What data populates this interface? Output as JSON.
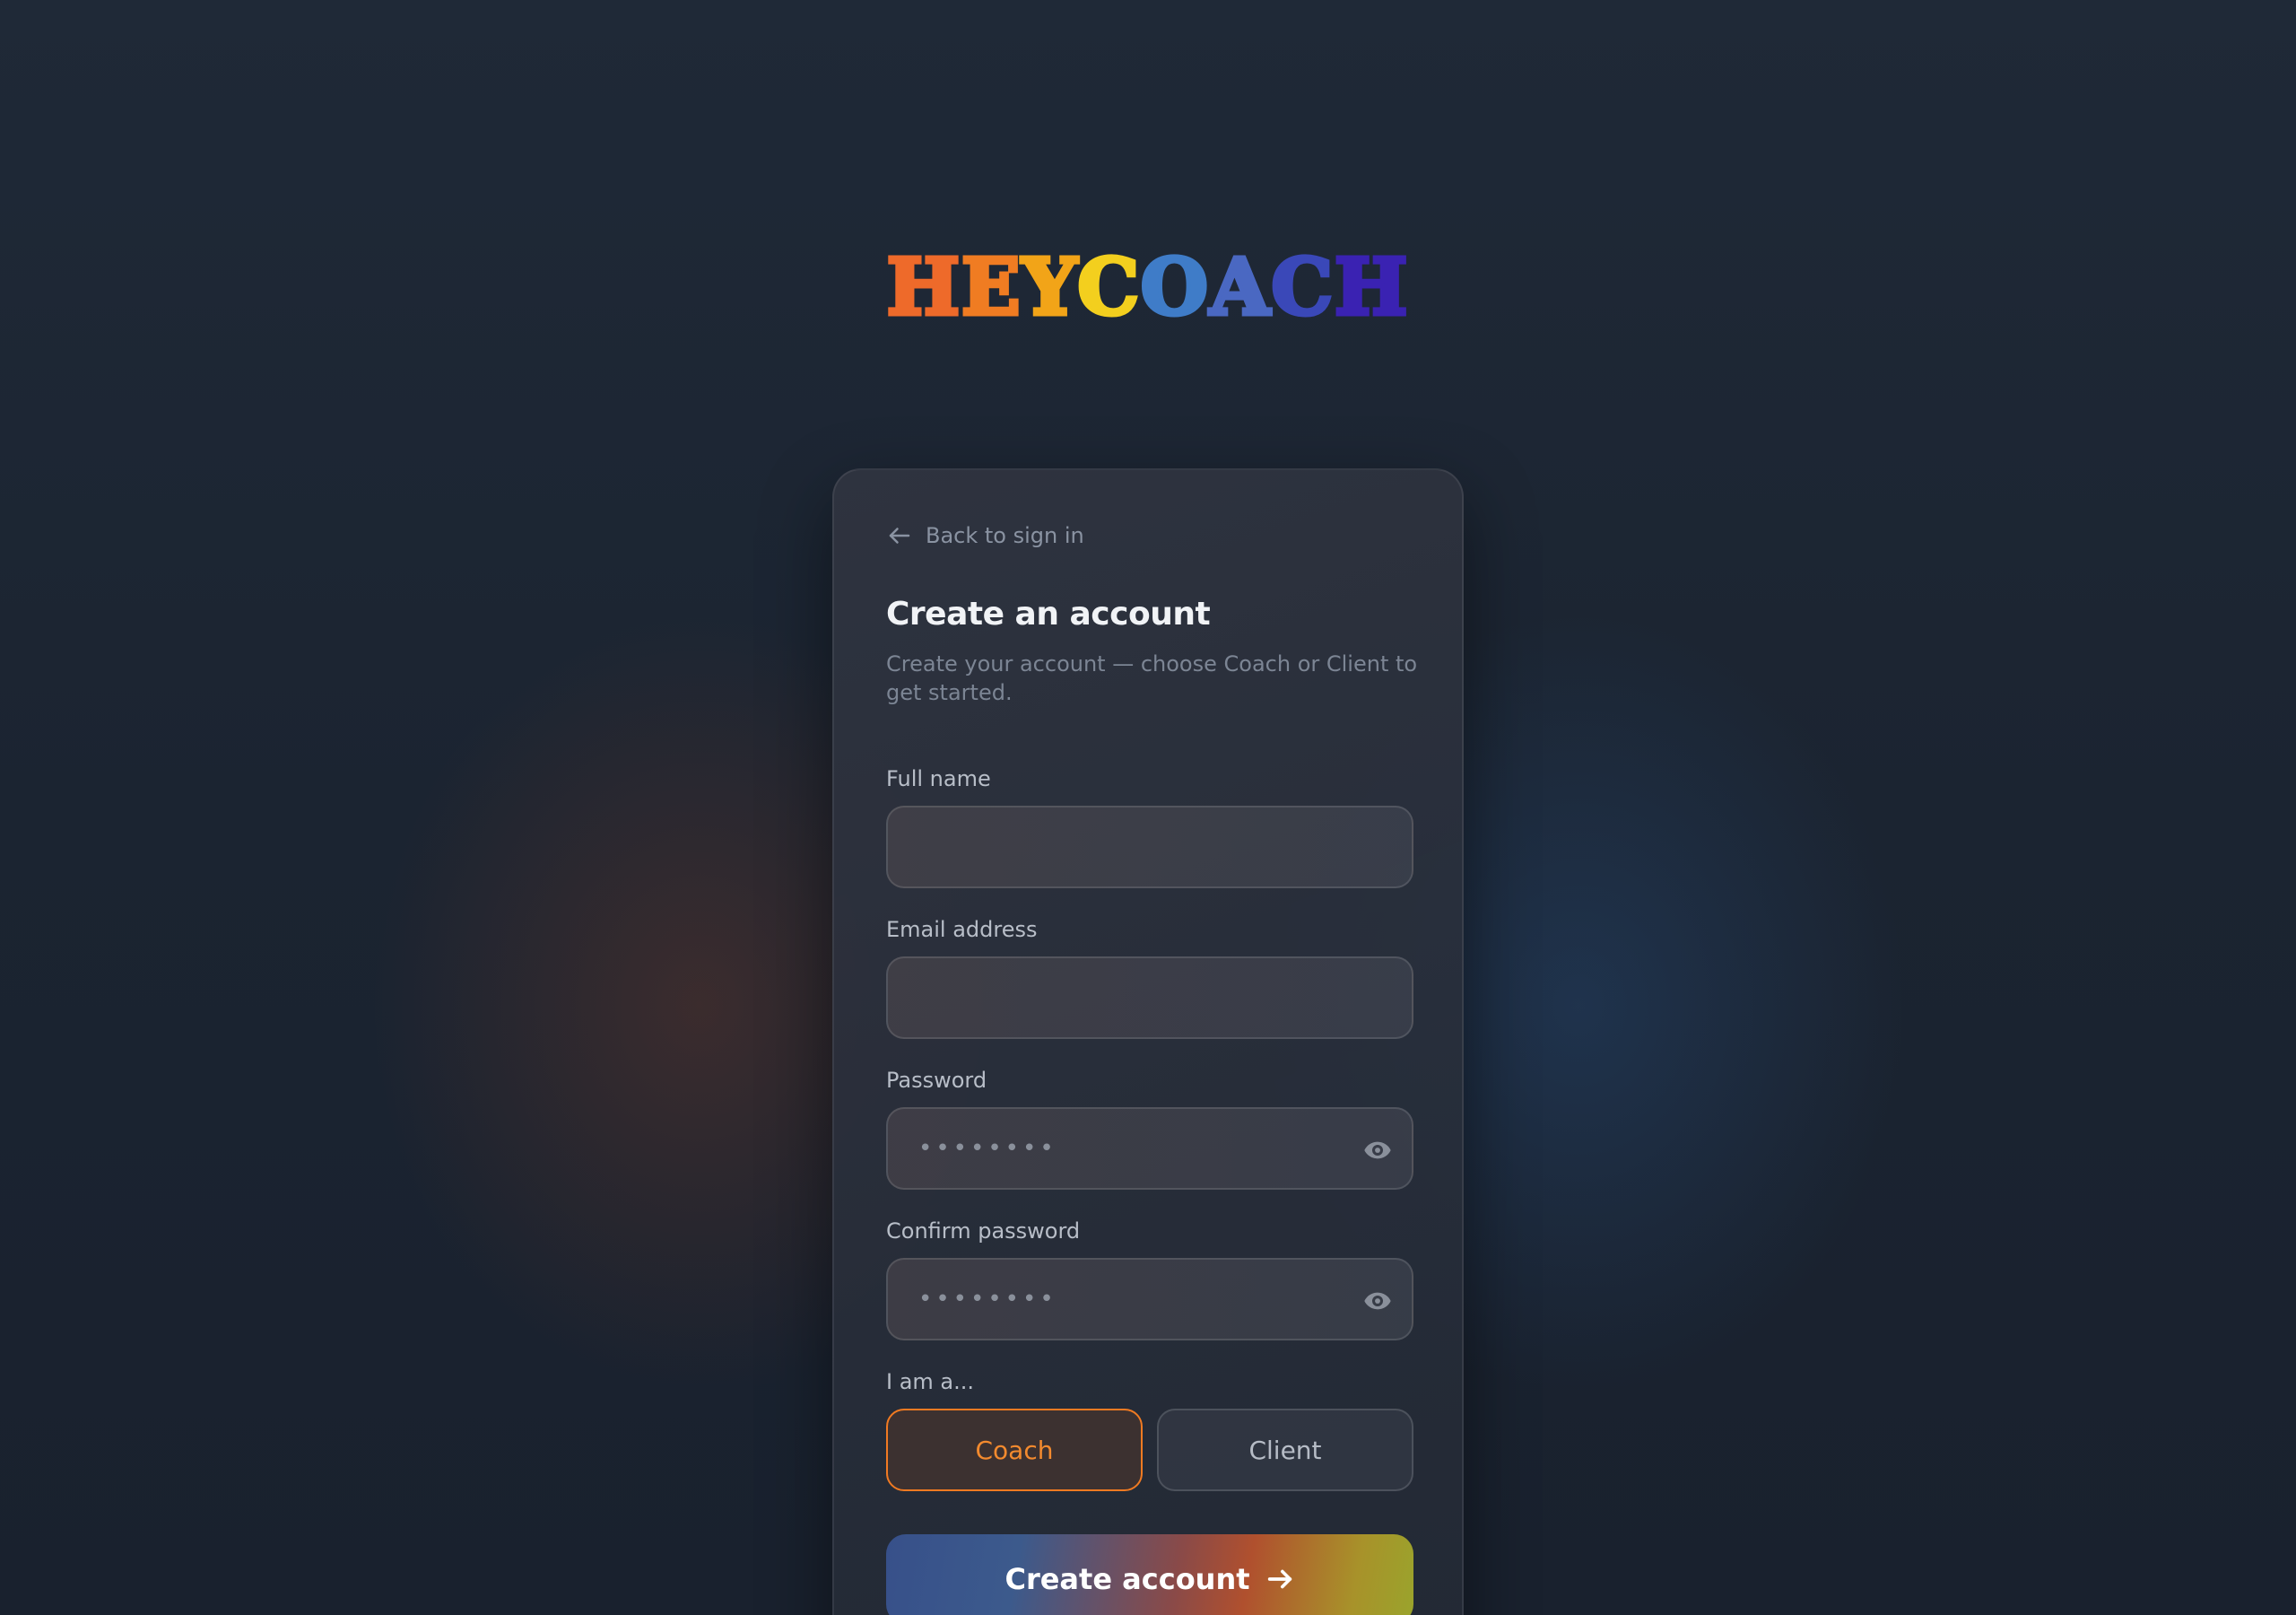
{
  "brand": {
    "letters": [
      {
        "char": "H",
        "color": "#ee6a2a"
      },
      {
        "char": "E",
        "color": "#f07c22"
      },
      {
        "char": "Y",
        "color": "#f2a418"
      },
      {
        "char": "C",
        "color": "#f3cf1e"
      },
      {
        "char": "O",
        "color": "#3f7cc8"
      },
      {
        "char": "A",
        "color": "#4a68c2"
      },
      {
        "char": "C",
        "color": "#3a48b8"
      },
      {
        "char": "H",
        "color": "#3a22b2"
      }
    ]
  },
  "card": {
    "back_link": "Back to sign in",
    "title": "Create an account",
    "subtitle": "Create your account — choose Coach or Client to get started."
  },
  "form": {
    "full_name": {
      "label": "Full name",
      "value": "",
      "placeholder": ""
    },
    "email": {
      "label": "Email address",
      "value": "",
      "placeholder": ""
    },
    "password": {
      "label": "Password",
      "value": "",
      "placeholder": "••••••••"
    },
    "confirm_password": {
      "label": "Confirm password",
      "value": "",
      "placeholder": "••••••••"
    },
    "role": {
      "label": "I am a...",
      "options": [
        "Coach",
        "Client"
      ],
      "selected": "Coach"
    },
    "submit_label": "Create account"
  },
  "colors": {
    "accent": "#f07a22",
    "background": "#1c2533"
  }
}
